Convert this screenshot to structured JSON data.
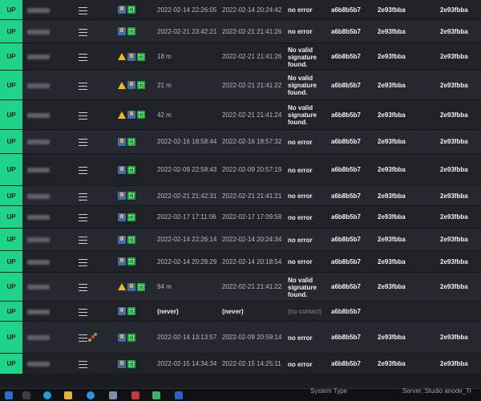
{
  "rows": [
    {
      "status": "UP",
      "menu_dots": false,
      "warn": false,
      "first_seen": "2022-02-14 22:26:05",
      "last_seen": "2022-02-14 20:24:42",
      "error": [
        "no error"
      ],
      "error_muted": false,
      "hash1": "a6b8b5b7",
      "hash2": "2e93fbba",
      "hash3": "2e93fbba"
    },
    {
      "status": "UP",
      "menu_dots": false,
      "warn": false,
      "first_seen": "2022-02-21 23:42:21",
      "last_seen": "2022-02-21 21:41:26",
      "error": [
        "no error"
      ],
      "error_muted": false,
      "hash1": "a6b8b5b7",
      "hash2": "2e93fbba",
      "hash3": "2e93fbba"
    },
    {
      "status": "UP",
      "menu_dots": false,
      "warn": true,
      "first_seen": "18 m",
      "last_seen": "2022-02-21 21:41:26",
      "error": [
        "No valid",
        "signature",
        "found."
      ],
      "error_muted": false,
      "hash1": "a6b8b5b7",
      "hash2": "2e93fbba",
      "hash3": "2e93fbba"
    },
    {
      "status": "UP",
      "menu_dots": false,
      "warn": true,
      "first_seen": "21 m",
      "last_seen": "2022-02-21 21:41:22",
      "error": [
        "No valid",
        "signature",
        "found."
      ],
      "error_muted": false,
      "hash1": "a6b8b5b7",
      "hash2": "2e93fbba",
      "hash3": "2e93fbba"
    },
    {
      "status": "UP",
      "menu_dots": false,
      "warn": true,
      "first_seen": "42 m",
      "last_seen": "2022-02-21 21:41:24",
      "error": [
        "No valid",
        "signature",
        "found."
      ],
      "error_muted": false,
      "hash1": "a6b8b5b7",
      "hash2": "2e93fbba",
      "hash3": "2e93fbba"
    },
    {
      "status": "UP",
      "menu_dots": false,
      "warn": false,
      "first_seen": "2022-02-16 18:58:44",
      "last_seen": "2022-02-16 18:57:32",
      "error": [
        "no error"
      ],
      "error_muted": false,
      "hash1": "a6b8b5b7",
      "hash2": "2e93fbba",
      "hash3": "2e93fbba"
    },
    {
      "status": "UP",
      "menu_dots": false,
      "warn": false,
      "first_seen": "2022-02-09 22:58:43",
      "last_seen": "2022-02-09 20:57:19",
      "error": [
        "no error"
      ],
      "error_muted": false,
      "hash1": "a6b8b5b7",
      "hash2": "2e93fbba",
      "hash3": "2e93fbba"
    },
    {
      "status": "UP",
      "menu_dots": false,
      "warn": false,
      "first_seen": "2022-02-21 21:42:31",
      "last_seen": "2022-02-21 21:41:21",
      "error": [
        "no error"
      ],
      "error_muted": false,
      "hash1": "a6b8b5b7",
      "hash2": "2e93fbba",
      "hash3": "2e93fbba"
    },
    {
      "status": "UP",
      "menu_dots": false,
      "warn": false,
      "first_seen": "2022-02-17 17:11:06",
      "last_seen": "2022-02-17 17:09:58",
      "error": [
        "no error"
      ],
      "error_muted": false,
      "hash1": "a6b8b5b7",
      "hash2": "2e93fbba",
      "hash3": "2e93fbba"
    },
    {
      "status": "UP",
      "menu_dots": false,
      "warn": false,
      "first_seen": "2022-02-14 22:26:14",
      "last_seen": "2022-02-14 20:24:34",
      "error": [
        "no error"
      ],
      "error_muted": false,
      "hash1": "a6b8b5b7",
      "hash2": "2e93fbba",
      "hash3": "2e93fbba"
    },
    {
      "status": "UP",
      "menu_dots": false,
      "warn": false,
      "first_seen": "2022-02-14 20:28:29",
      "last_seen": "2022-02-14 20:18:54",
      "error": [
        "no error"
      ],
      "error_muted": false,
      "hash1": "a6b8b5b7",
      "hash2": "2e93fbba",
      "hash3": "2e93fbba"
    },
    {
      "status": "UP",
      "menu_dots": false,
      "warn": true,
      "first_seen": "94 m",
      "last_seen": "2022-02-21 21:41:22",
      "error": [
        "No valid",
        "signature",
        "found."
      ],
      "error_muted": false,
      "hash1": "a6b8b5b7",
      "hash2": "2e93fbba",
      "hash3": "2e93fbba"
    },
    {
      "status": "UP",
      "menu_dots": false,
      "warn": false,
      "first_seen": "(never)",
      "last_seen": "(never)",
      "error": [
        "(no contact)"
      ],
      "error_muted": true,
      "hash1": "a6b8b5b7",
      "hash2": "",
      "hash3": ""
    },
    {
      "status": "UP",
      "menu_dots": true,
      "warn": false,
      "first_seen": "2022-02-14 13:13:57",
      "last_seen": "2022-02-09 20:59:14",
      "error": [
        "no error"
      ],
      "error_muted": false,
      "hash1": "a6b8b5b7",
      "hash2": "2e93fbba",
      "hash3": "2e93fbba"
    },
    {
      "status": "UP",
      "menu_dots": false,
      "warn": false,
      "first_seen": "2022-02-15 14:34:34",
      "last_seen": "2022-02-15 14:25:11",
      "error": [
        "no error"
      ],
      "error_muted": false,
      "hash1": "a6b8b5b7",
      "hash2": "2e93fbba",
      "hash3": "2e93fbba"
    }
  ],
  "taskbar": {
    "text_left": "System Type",
    "text_right": "Server, Studio anode_Tr"
  },
  "colors": {
    "status_up": "#1fd38a",
    "row_odd": "#1f2227",
    "row_even": "#25282e",
    "warning": "#f2b81c"
  }
}
